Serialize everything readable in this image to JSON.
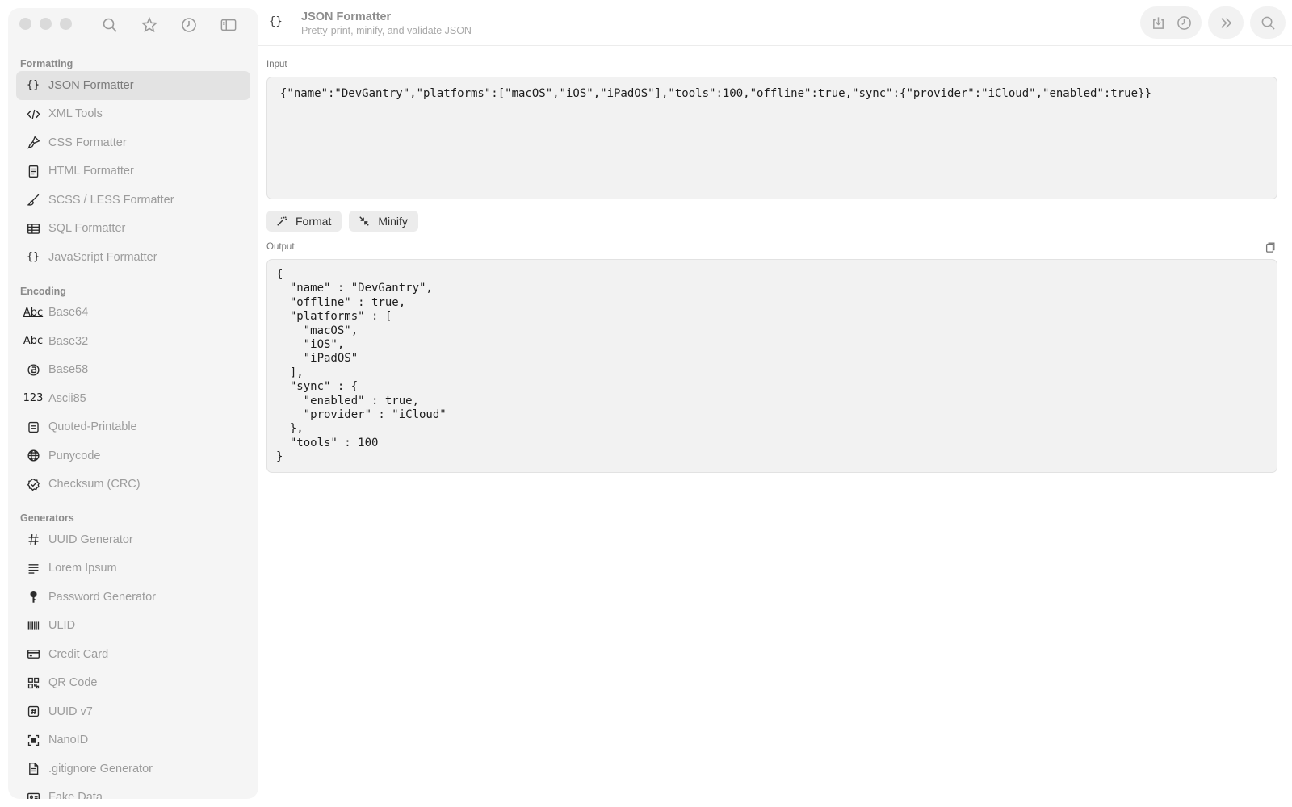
{
  "header": {
    "icon_text": "{}",
    "title": "JSON Formatter",
    "subtitle": "Pretty-print, minify, and validate JSON"
  },
  "sidebar": {
    "sections": [
      {
        "title": "Formatting",
        "items": [
          {
            "label": "JSON Formatter",
            "icon": "braces-icon",
            "active": true
          },
          {
            "label": "XML Tools",
            "icon": "code-brackets-icon"
          },
          {
            "label": "CSS Formatter",
            "icon": "paintbrush-icon"
          },
          {
            "label": "HTML Formatter",
            "icon": "document-icon"
          },
          {
            "label": "SCSS / LESS Formatter",
            "icon": "brush-icon"
          },
          {
            "label": "SQL Formatter",
            "icon": "table-icon"
          },
          {
            "label": "JavaScript Formatter",
            "icon": "braces-icon"
          }
        ]
      },
      {
        "title": "Encoding",
        "items": [
          {
            "label": "Base64",
            "icon": "abc-text-icon",
            "icon_text": "Abc"
          },
          {
            "label": "Base32",
            "icon": "abc-text-icon",
            "icon_text": "Abc"
          },
          {
            "label": "Base58",
            "icon": "bitcoin-circle-icon"
          },
          {
            "label": "Ascii85",
            "icon": "numbers-icon",
            "icon_text": "123"
          },
          {
            "label": "Quoted-Printable",
            "icon": "text-box-icon"
          },
          {
            "label": "Punycode",
            "icon": "globe-icon"
          },
          {
            "label": "Checksum (CRC)",
            "icon": "checkmark-seal-icon"
          }
        ]
      },
      {
        "title": "Generators",
        "items": [
          {
            "label": "UUID Generator",
            "icon": "hash-icon"
          },
          {
            "label": "Lorem Ipsum",
            "icon": "text-lines-icon"
          },
          {
            "label": "Password Generator",
            "icon": "key-icon"
          },
          {
            "label": "ULID",
            "icon": "barcode-icon"
          },
          {
            "label": "Credit Card",
            "icon": "credit-card-icon"
          },
          {
            "label": "QR Code",
            "icon": "qr-code-icon"
          },
          {
            "label": "UUID v7",
            "icon": "hash-square-icon"
          },
          {
            "label": "NanoID",
            "icon": "viewfinder-icon"
          },
          {
            "label": ".gitignore Generator",
            "icon": "file-text-icon"
          },
          {
            "label": "Fake Data",
            "icon": "id-card-icon"
          }
        ]
      }
    ]
  },
  "input": {
    "label": "Input",
    "value": "{\"name\":\"DevGantry\",\"platforms\":[\"macOS\",\"iOS\",\"iPadOS\"],\"tools\":100,\"offline\":true,\"sync\":{\"provider\":\"iCloud\",\"enabled\":true}}"
  },
  "actions": {
    "format_label": "Format",
    "minify_label": "Minify"
  },
  "output": {
    "label": "Output",
    "value": "{\n  \"name\" : \"DevGantry\",\n  \"offline\" : true,\n  \"platforms\" : [\n    \"macOS\",\n    \"iOS\",\n    \"iPadOS\"\n  ],\n  \"sync\" : {\n    \"enabled\" : true,\n    \"provider\" : \"iCloud\"\n  },\n  \"tools\" : 100\n}"
  }
}
